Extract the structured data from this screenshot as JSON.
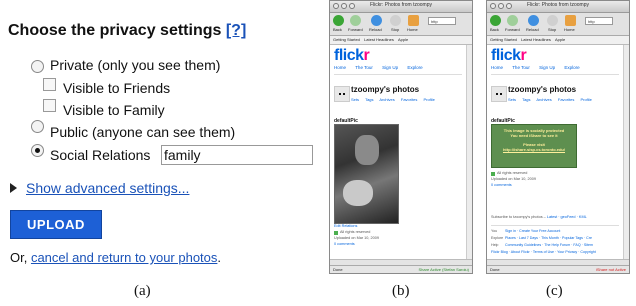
{
  "panel_a": {
    "title": "Choose the privacy settings",
    "help_link": "[?]",
    "options": {
      "private": "Private (only you see them)",
      "friends": "Visible to Friends",
      "family": "Visible to Family",
      "public": "Public (anyone can see them)",
      "social": "Social Relations"
    },
    "social_value": "family",
    "advanced_link": "Show advanced settings...",
    "upload_label": "UPLOAD",
    "or_text": "Or, ",
    "cancel_link": "cancel and return to your photos",
    "cancel_suffix": "."
  },
  "captions": {
    "a": "(a)",
    "b": "(b)",
    "c": "(c)"
  },
  "browser": {
    "title": "Flickr: Photos from tzoompy",
    "toolbar": {
      "back": "Back",
      "forward": "Forward",
      "reload": "Reload",
      "stop": "Stop",
      "home": "Home",
      "url": "http"
    },
    "bookmarks": [
      "Getting Started",
      "Latest Headlines",
      "Apple"
    ],
    "logo_main": "flick",
    "logo_accent": "r",
    "nav": [
      "Home",
      "The Tour",
      "Sign Up",
      "Explore"
    ],
    "profile_name": "tzoompy's photos",
    "profile_links": [
      "Sets",
      "Tags",
      "Archives",
      "Favorites",
      "Profile"
    ],
    "photo_title": "defaultPic",
    "rights": "All rights reserved",
    "uploaded": "Uploaded on Mar 10, 2009",
    "comments": "0 comments",
    "status_done": "Done"
  },
  "browser_b": {
    "edit_relations": "Edit Relations",
    "status_right": "Share Active (Stefan Saroiu)"
  },
  "browser_c": {
    "protected_line1": "This image is socially protected",
    "protected_line2": "You need iShare to see it",
    "protected_line3": "Please visit",
    "protected_line4": "http://ishare.sisp.cs.toronto.edu/",
    "subscribe": "Subscribe to tzoompy's photos –",
    "subscribe_links": "Latest · geoFeed · KML",
    "footer": [
      {
        "k": "You",
        "v": "Sign in · Create Your Free Account"
      },
      {
        "k": "Explore",
        "v": "Places · Last 7 Days · This Month · Popular Tags · Cre"
      },
      {
        "k": "Help",
        "v": "Community Guidelines · The Help Forum · FAQ · Sitem"
      },
      {
        "k": "",
        "v": "Flickr Blog · About Flickr · Terms of Use · Your Privacy · Copyright"
      }
    ],
    "status_right": "iShare not Active"
  },
  "colors": {
    "flickr_blue": "#0063dc",
    "flickr_pink": "#ff0084",
    "upload_blue": "#1d60d6",
    "protected_green": "#5e8f4f"
  }
}
